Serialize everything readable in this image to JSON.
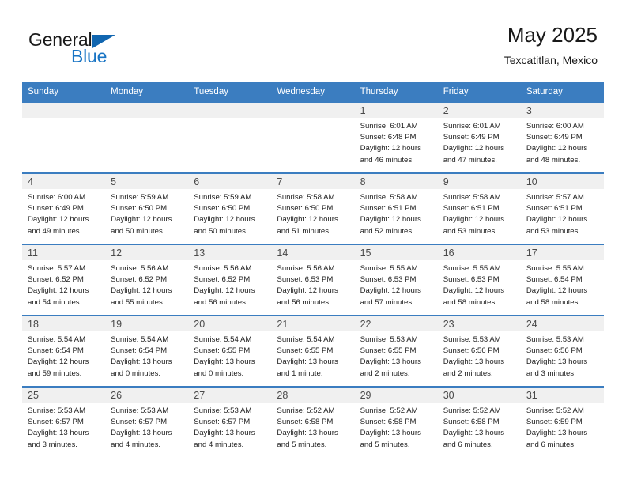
{
  "brand": {
    "name_part1": "General",
    "name_part2": "Blue",
    "triangle_color": "#1166b0",
    "blue_color": "#1874c4"
  },
  "header": {
    "title": "May 2025",
    "subtitle": "Texcatitlan, Mexico"
  },
  "theme": {
    "header_bg": "#3b7dc0",
    "daynum_band_bg": "#f0f0f0",
    "grid_line": "#3b7dc0"
  },
  "weekday_headers": [
    "Sunday",
    "Monday",
    "Tuesday",
    "Wednesday",
    "Thursday",
    "Friday",
    "Saturday"
  ],
  "weeks": [
    [
      {
        "day": "",
        "sunrise": "",
        "sunset": "",
        "daylight1": "",
        "daylight2": ""
      },
      {
        "day": "",
        "sunrise": "",
        "sunset": "",
        "daylight1": "",
        "daylight2": ""
      },
      {
        "day": "",
        "sunrise": "",
        "sunset": "",
        "daylight1": "",
        "daylight2": ""
      },
      {
        "day": "",
        "sunrise": "",
        "sunset": "",
        "daylight1": "",
        "daylight2": ""
      },
      {
        "day": "1",
        "sunrise": "Sunrise: 6:01 AM",
        "sunset": "Sunset: 6:48 PM",
        "daylight1": "Daylight: 12 hours",
        "daylight2": "and 46 minutes."
      },
      {
        "day": "2",
        "sunrise": "Sunrise: 6:01 AM",
        "sunset": "Sunset: 6:49 PM",
        "daylight1": "Daylight: 12 hours",
        "daylight2": "and 47 minutes."
      },
      {
        "day": "3",
        "sunrise": "Sunrise: 6:00 AM",
        "sunset": "Sunset: 6:49 PM",
        "daylight1": "Daylight: 12 hours",
        "daylight2": "and 48 minutes."
      }
    ],
    [
      {
        "day": "4",
        "sunrise": "Sunrise: 6:00 AM",
        "sunset": "Sunset: 6:49 PM",
        "daylight1": "Daylight: 12 hours",
        "daylight2": "and 49 minutes."
      },
      {
        "day": "5",
        "sunrise": "Sunrise: 5:59 AM",
        "sunset": "Sunset: 6:50 PM",
        "daylight1": "Daylight: 12 hours",
        "daylight2": "and 50 minutes."
      },
      {
        "day": "6",
        "sunrise": "Sunrise: 5:59 AM",
        "sunset": "Sunset: 6:50 PM",
        "daylight1": "Daylight: 12 hours",
        "daylight2": "and 50 minutes."
      },
      {
        "day": "7",
        "sunrise": "Sunrise: 5:58 AM",
        "sunset": "Sunset: 6:50 PM",
        "daylight1": "Daylight: 12 hours",
        "daylight2": "and 51 minutes."
      },
      {
        "day": "8",
        "sunrise": "Sunrise: 5:58 AM",
        "sunset": "Sunset: 6:51 PM",
        "daylight1": "Daylight: 12 hours",
        "daylight2": "and 52 minutes."
      },
      {
        "day": "9",
        "sunrise": "Sunrise: 5:58 AM",
        "sunset": "Sunset: 6:51 PM",
        "daylight1": "Daylight: 12 hours",
        "daylight2": "and 53 minutes."
      },
      {
        "day": "10",
        "sunrise": "Sunrise: 5:57 AM",
        "sunset": "Sunset: 6:51 PM",
        "daylight1": "Daylight: 12 hours",
        "daylight2": "and 53 minutes."
      }
    ],
    [
      {
        "day": "11",
        "sunrise": "Sunrise: 5:57 AM",
        "sunset": "Sunset: 6:52 PM",
        "daylight1": "Daylight: 12 hours",
        "daylight2": "and 54 minutes."
      },
      {
        "day": "12",
        "sunrise": "Sunrise: 5:56 AM",
        "sunset": "Sunset: 6:52 PM",
        "daylight1": "Daylight: 12 hours",
        "daylight2": "and 55 minutes."
      },
      {
        "day": "13",
        "sunrise": "Sunrise: 5:56 AM",
        "sunset": "Sunset: 6:52 PM",
        "daylight1": "Daylight: 12 hours",
        "daylight2": "and 56 minutes."
      },
      {
        "day": "14",
        "sunrise": "Sunrise: 5:56 AM",
        "sunset": "Sunset: 6:53 PM",
        "daylight1": "Daylight: 12 hours",
        "daylight2": "and 56 minutes."
      },
      {
        "day": "15",
        "sunrise": "Sunrise: 5:55 AM",
        "sunset": "Sunset: 6:53 PM",
        "daylight1": "Daylight: 12 hours",
        "daylight2": "and 57 minutes."
      },
      {
        "day": "16",
        "sunrise": "Sunrise: 5:55 AM",
        "sunset": "Sunset: 6:53 PM",
        "daylight1": "Daylight: 12 hours",
        "daylight2": "and 58 minutes."
      },
      {
        "day": "17",
        "sunrise": "Sunrise: 5:55 AM",
        "sunset": "Sunset: 6:54 PM",
        "daylight1": "Daylight: 12 hours",
        "daylight2": "and 58 minutes."
      }
    ],
    [
      {
        "day": "18",
        "sunrise": "Sunrise: 5:54 AM",
        "sunset": "Sunset: 6:54 PM",
        "daylight1": "Daylight: 12 hours",
        "daylight2": "and 59 minutes."
      },
      {
        "day": "19",
        "sunrise": "Sunrise: 5:54 AM",
        "sunset": "Sunset: 6:54 PM",
        "daylight1": "Daylight: 13 hours",
        "daylight2": "and 0 minutes."
      },
      {
        "day": "20",
        "sunrise": "Sunrise: 5:54 AM",
        "sunset": "Sunset: 6:55 PM",
        "daylight1": "Daylight: 13 hours",
        "daylight2": "and 0 minutes."
      },
      {
        "day": "21",
        "sunrise": "Sunrise: 5:54 AM",
        "sunset": "Sunset: 6:55 PM",
        "daylight1": "Daylight: 13 hours",
        "daylight2": "and 1 minute."
      },
      {
        "day": "22",
        "sunrise": "Sunrise: 5:53 AM",
        "sunset": "Sunset: 6:55 PM",
        "daylight1": "Daylight: 13 hours",
        "daylight2": "and 2 minutes."
      },
      {
        "day": "23",
        "sunrise": "Sunrise: 5:53 AM",
        "sunset": "Sunset: 6:56 PM",
        "daylight1": "Daylight: 13 hours",
        "daylight2": "and 2 minutes."
      },
      {
        "day": "24",
        "sunrise": "Sunrise: 5:53 AM",
        "sunset": "Sunset: 6:56 PM",
        "daylight1": "Daylight: 13 hours",
        "daylight2": "and 3 minutes."
      }
    ],
    [
      {
        "day": "25",
        "sunrise": "Sunrise: 5:53 AM",
        "sunset": "Sunset: 6:57 PM",
        "daylight1": "Daylight: 13 hours",
        "daylight2": "and 3 minutes."
      },
      {
        "day": "26",
        "sunrise": "Sunrise: 5:53 AM",
        "sunset": "Sunset: 6:57 PM",
        "daylight1": "Daylight: 13 hours",
        "daylight2": "and 4 minutes."
      },
      {
        "day": "27",
        "sunrise": "Sunrise: 5:53 AM",
        "sunset": "Sunset: 6:57 PM",
        "daylight1": "Daylight: 13 hours",
        "daylight2": "and 4 minutes."
      },
      {
        "day": "28",
        "sunrise": "Sunrise: 5:52 AM",
        "sunset": "Sunset: 6:58 PM",
        "daylight1": "Daylight: 13 hours",
        "daylight2": "and 5 minutes."
      },
      {
        "day": "29",
        "sunrise": "Sunrise: 5:52 AM",
        "sunset": "Sunset: 6:58 PM",
        "daylight1": "Daylight: 13 hours",
        "daylight2": "and 5 minutes."
      },
      {
        "day": "30",
        "sunrise": "Sunrise: 5:52 AM",
        "sunset": "Sunset: 6:58 PM",
        "daylight1": "Daylight: 13 hours",
        "daylight2": "and 6 minutes."
      },
      {
        "day": "31",
        "sunrise": "Sunrise: 5:52 AM",
        "sunset": "Sunset: 6:59 PM",
        "daylight1": "Daylight: 13 hours",
        "daylight2": "and 6 minutes."
      }
    ]
  ]
}
